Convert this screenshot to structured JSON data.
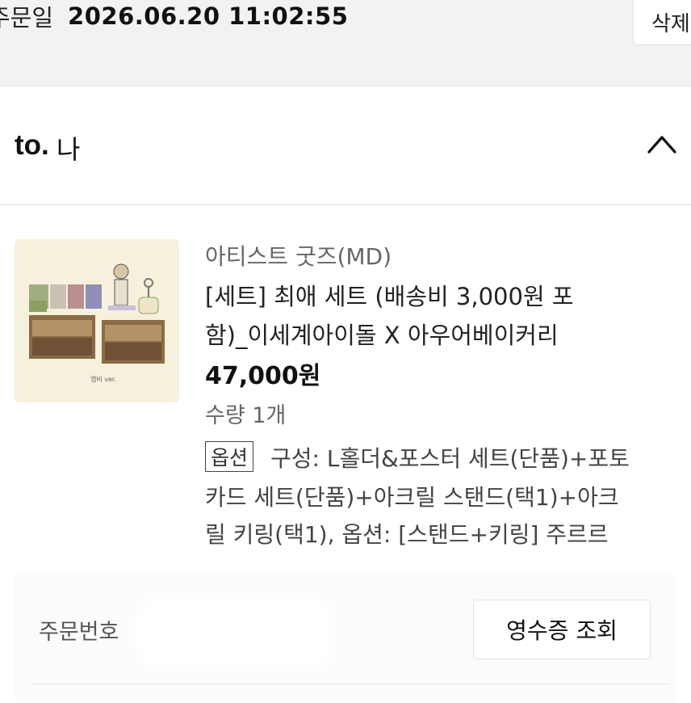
{
  "order": {
    "date_label": "주문일",
    "date_value": "2026.06.20 11:02:55",
    "delete_label": "삭제"
  },
  "seller": {
    "to_prefix": "to.",
    "name": "나"
  },
  "product": {
    "category": "아티스트 굿즈(MD)",
    "title_lines": [
      "[세트] 최애 세트 (배송비 3,000원 포",
      "함)_이세계아이돌 X 아우어베이커리"
    ],
    "price": "47,000원",
    "quantity": "수량 1개",
    "option_badge": "옵션",
    "option_lines": [
      "구성: L홀더&포스터 세트(단품)+포토",
      "카드 세트(단품)+아크릴 스탠드(택1)+아크",
      "릴 키링(택1), 옵션: [스탠드+키링] 주르르"
    ],
    "thumbnail_caption": "엠비 ver."
  },
  "order_info": {
    "order_no_label": "주문번호",
    "order_no_value": "",
    "receipt_button": "영수증 조회"
  },
  "icons": {
    "collapse": "chevron-up-icon"
  }
}
